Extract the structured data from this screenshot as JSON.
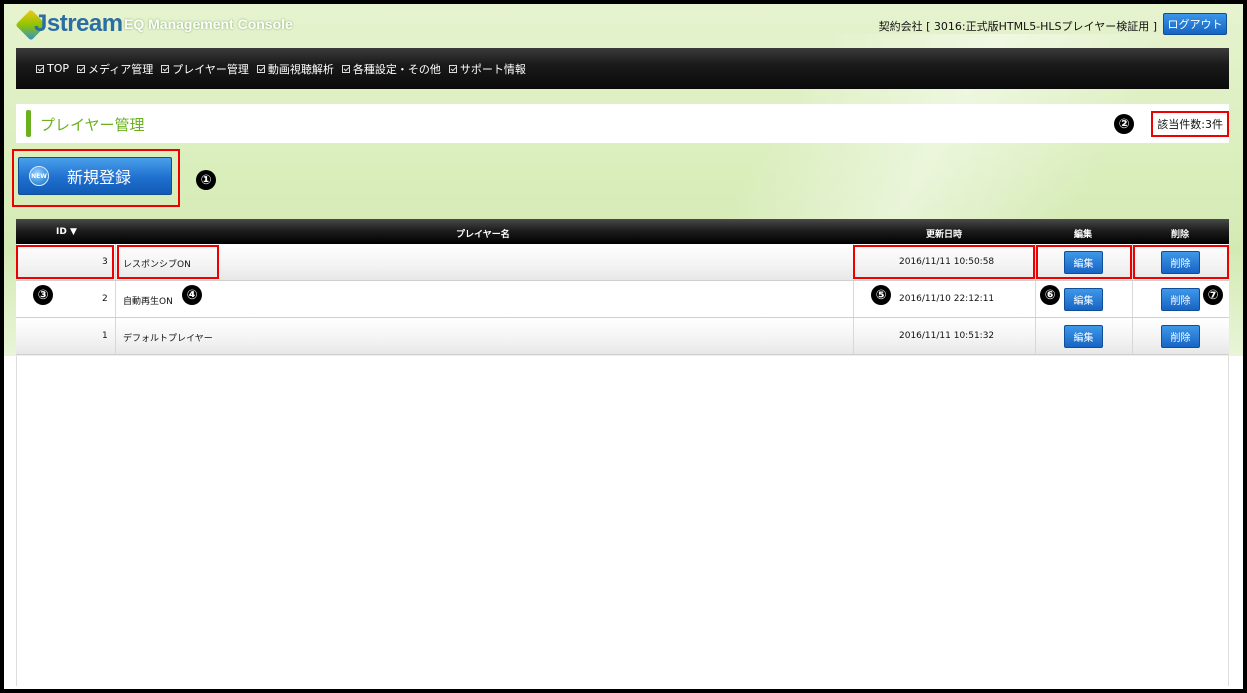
{
  "header": {
    "logo_text": "Jstream",
    "app_title": "EQ Management Console",
    "contract": "契約会社 [ 3016:正式版HTML5-HLSプレイヤー検証用 ]",
    "logout_label": "ログアウト"
  },
  "nav": {
    "items": [
      {
        "label": "TOP"
      },
      {
        "label": "メディア管理"
      },
      {
        "label": "プレイヤー管理"
      },
      {
        "label": "動画視聴解析"
      },
      {
        "label": "各種設定・その他"
      },
      {
        "label": "サポート情報"
      }
    ]
  },
  "page": {
    "title": "プレイヤー管理",
    "count_label": "該当件数:3件",
    "new_button_label": "新規登録",
    "new_icon_text": "NEW"
  },
  "annotations": {
    "n1": "①",
    "n2": "②",
    "n3": "③",
    "n4": "④",
    "n5": "⑤",
    "n6": "⑥",
    "n7": "⑦"
  },
  "table": {
    "headers": {
      "id": "ID ▼",
      "name": "プレイヤー名",
      "updated": "更新日時",
      "edit": "編集",
      "delete": "削除"
    },
    "rows": [
      {
        "id": "3",
        "name": "レスポンシブON",
        "updated": "2016/11/11 10:50:58",
        "edit": "編集",
        "delete": "削除"
      },
      {
        "id": "2",
        "name": "自動再生ON",
        "updated": "2016/11/10 22:12:11",
        "edit": "編集",
        "delete": "削除"
      },
      {
        "id": "1",
        "name": "デフォルトプレイヤー",
        "updated": "2016/11/11 10:51:32",
        "edit": "編集",
        "delete": "削除"
      }
    ]
  },
  "colors": {
    "accent_green": "#6ab01f",
    "button_blue": "#1e6fcf",
    "highlight_red": "#e00000"
  }
}
